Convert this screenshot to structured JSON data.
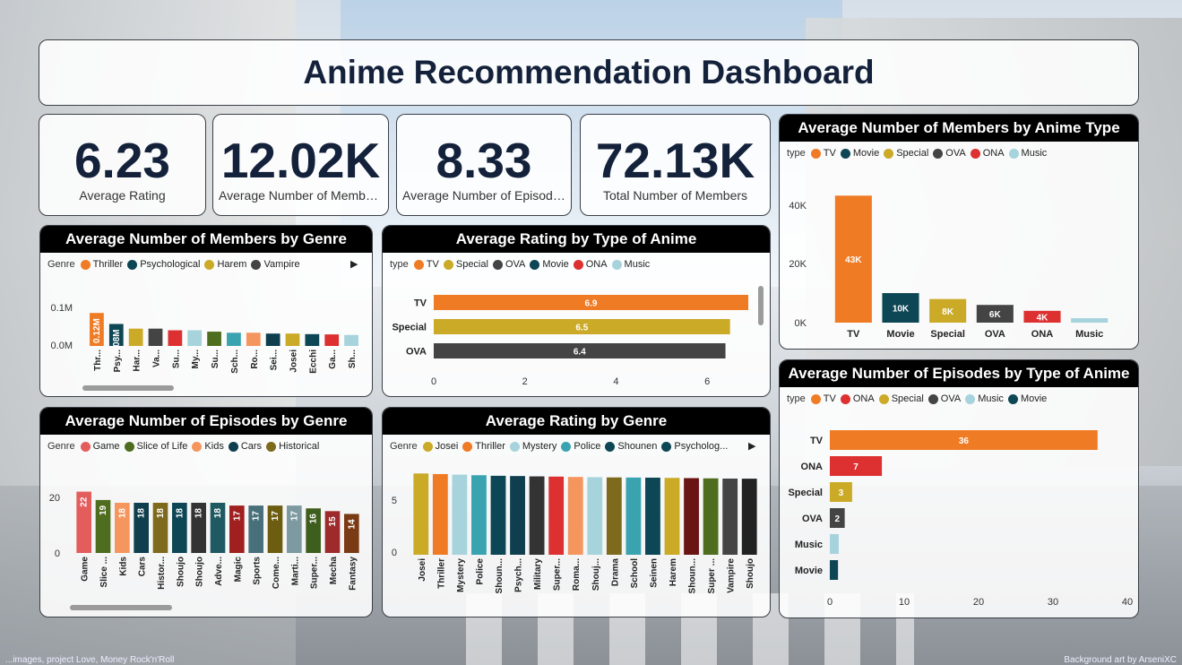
{
  "colors": {
    "TV": "#f07b25",
    "Movie": "#0d4654",
    "Special": "#cbaa27",
    "OVA": "#444444",
    "ONA": "#dd3030",
    "Music": "#a6d3dc"
  },
  "header": {
    "title": "Anime Recommendation Dashboard"
  },
  "kpis": [
    {
      "value": "6.23",
      "label": "Average Rating"
    },
    {
      "value": "12.02K",
      "label": "Average Number of Members"
    },
    {
      "value": "8.33",
      "label": "Average Number of Episodes"
    },
    {
      "value": "72.13K",
      "label": "Total Number of Members"
    }
  ],
  "chart_data": [
    {
      "id": "members_by_genre",
      "type": "bar",
      "title": "Average Number of Members by Genre",
      "legend_title": "Genre",
      "legend": [
        {
          "name": "Thriller",
          "color": "#f07b25"
        },
        {
          "name": "Psychological",
          "color": "#0d4654"
        },
        {
          "name": "Harem",
          "color": "#cbaa27"
        },
        {
          "name": "Vampire",
          "color": "#444444"
        }
      ],
      "yticks": [
        "0.1M",
        "0.0M"
      ],
      "ylim": [
        0,
        0.15
      ],
      "categories": [
        "Thr...",
        "Psy...",
        "Har...",
        "Va...",
        "Su...",
        "My...",
        "Su...",
        "Sch...",
        "Ro...",
        "Sei...",
        "Josei",
        "Ecchi",
        "Ga...",
        "Sh..."
      ],
      "values": [
        0.12,
        0.08,
        0.063,
        0.063,
        0.057,
        0.057,
        0.052,
        0.048,
        0.048,
        0.045,
        0.045,
        0.043,
        0.042,
        0.04
      ],
      "labels": [
        "0.12M",
        "0.08M",
        "",
        "",
        "",
        "",
        "",
        "",
        "",
        "",
        "",
        "",
        "",
        ""
      ],
      "bar_colors": [
        "#f07b25",
        "#0d4654",
        "#cbaa27",
        "#444444",
        "#dd3030",
        "#a6d3dc",
        "#4f6d1f",
        "#3aa3b0",
        "#f4965d",
        "#0f3e4e",
        "#cbaa27",
        "#0d4654",
        "#dd3030",
        "#a6d3dc"
      ]
    },
    {
      "id": "rating_by_type",
      "type": "bar",
      "orientation": "horizontal",
      "title": "Average Rating by Type of Anime",
      "legend_title": "type",
      "legend": [
        {
          "name": "TV",
          "color": "#f07b25"
        },
        {
          "name": "Special",
          "color": "#cbaa27"
        },
        {
          "name": "OVA",
          "color": "#444444"
        },
        {
          "name": "Movie",
          "color": "#0d4654"
        },
        {
          "name": "ONA",
          "color": "#dd3030"
        },
        {
          "name": "Music",
          "color": "#a6d3dc"
        }
      ],
      "categories": [
        "TV",
        "Special",
        "OVA"
      ],
      "values": [
        6.9,
        6.5,
        6.4
      ],
      "labels": [
        "6.9",
        "6.5",
        "6.4"
      ],
      "bar_colors": [
        "#f07b25",
        "#cbaa27",
        "#444444"
      ],
      "xticks": [
        "0",
        "2",
        "4",
        "6"
      ],
      "xlim": [
        0,
        6.9
      ]
    },
    {
      "id": "members_by_type",
      "type": "bar",
      "title": "Average Number of Members by Anime Type",
      "legend_title": "type",
      "legend": [
        {
          "name": "TV",
          "color": "#f07b25"
        },
        {
          "name": "Movie",
          "color": "#0d4654"
        },
        {
          "name": "Special",
          "color": "#cbaa27"
        },
        {
          "name": "OVA",
          "color": "#444444"
        },
        {
          "name": "ONA",
          "color": "#dd3030"
        },
        {
          "name": "Music",
          "color": "#a6d3dc"
        }
      ],
      "yticks": [
        "40K",
        "20K",
        "0K"
      ],
      "ylim": [
        0,
        40000
      ],
      "categories": [
        "TV",
        "Movie",
        "Special",
        "OVA",
        "ONA",
        "Music"
      ],
      "values": [
        43000,
        10000,
        8000,
        6000,
        4000,
        1500
      ],
      "labels": [
        "43K",
        "10K",
        "8K",
        "6K",
        "4K",
        ""
      ],
      "bar_colors": [
        "#f07b25",
        "#0d4654",
        "#cbaa27",
        "#444444",
        "#dd3030",
        "#a6d3dc"
      ]
    },
    {
      "id": "episodes_by_genre",
      "type": "bar",
      "title": "Average Number of Episodes by Genre",
      "legend_title": "Genre",
      "legend": [
        {
          "name": "Game",
          "color": "#e35d5d"
        },
        {
          "name": "Slice of Life",
          "color": "#4f6d1f"
        },
        {
          "name": "Kids",
          "color": "#f4965d"
        },
        {
          "name": "Cars",
          "color": "#0f3e4e"
        },
        {
          "name": "Historical",
          "color": "#7d6a1c"
        }
      ],
      "yticks": [
        "20",
        "0"
      ],
      "ylim": [
        0,
        20
      ],
      "categories": [
        "Game",
        "Slice ...",
        "Kids",
        "Cars",
        "Histor...",
        "Shoujo",
        "Shoujo",
        "Adve...",
        "Magic",
        "Sports",
        "Come...",
        "Marti...",
        "Super...",
        "Mecha",
        "Fantasy"
      ],
      "values": [
        22,
        19,
        18,
        18,
        18,
        18,
        18,
        18,
        17,
        17,
        17,
        17,
        16,
        15,
        14
      ],
      "labels": [
        "22",
        "19",
        "18",
        "18",
        "18",
        "18",
        "18",
        "18",
        "17",
        "17",
        "17",
        "17",
        "16",
        "15",
        "14"
      ],
      "bar_colors": [
        "#e35d5d",
        "#4f6d1f",
        "#f4965d",
        "#0f3e4e",
        "#7d6a1c",
        "#0d4654",
        "#333333",
        "#1f5a63",
        "#a01f1f",
        "#48707a",
        "#6c5d10",
        "#7c9aa0",
        "#3e5e1d",
        "#9e2b2b",
        "#7a3b14"
      ]
    },
    {
      "id": "rating_by_genre",
      "type": "bar",
      "title": "Average Rating by Genre",
      "legend_title": "Genre",
      "legend": [
        {
          "name": "Josei",
          "color": "#cbaa27"
        },
        {
          "name": "Thriller",
          "color": "#f07b25"
        },
        {
          "name": "Mystery",
          "color": "#a6d3dc"
        },
        {
          "name": "Police",
          "color": "#3aa3b0"
        },
        {
          "name": "Shounen",
          "color": "#0d4654"
        },
        {
          "name": "Psycholog...",
          "color": "#0d4654"
        }
      ],
      "yticks": [
        "5",
        "0"
      ],
      "ylim": [
        0,
        5
      ],
      "categories": [
        "Josei",
        "Thriller",
        "Mystery",
        "Police",
        "Shoun...",
        "Psych...",
        "Military",
        "Super...",
        "Roma...",
        "Shouj...",
        "Drama",
        "School",
        "Seinen",
        "Harem",
        "Shoun...",
        "Super ...",
        "Vampire",
        "Shoujo"
      ],
      "values": [
        7.0,
        6.95,
        6.9,
        6.85,
        6.8,
        6.78,
        6.75,
        6.73,
        6.7,
        6.68,
        6.66,
        6.65,
        6.64,
        6.62,
        6.6,
        6.58,
        6.56,
        6.55
      ],
      "bar_colors": [
        "#cbaa27",
        "#f07b25",
        "#a6d3dc",
        "#3aa3b0",
        "#0d4654",
        "#0f3e4e",
        "#333333",
        "#dd3030",
        "#f4965d",
        "#a6d3dc",
        "#7d6a1c",
        "#3aa3b0",
        "#0d4654",
        "#cbaa27",
        "#6b1414",
        "#4f6d1f",
        "#444444",
        "#222222"
      ]
    },
    {
      "id": "episodes_by_type",
      "type": "bar",
      "orientation": "horizontal",
      "title": "Average Number of Episodes by Type of Anime",
      "legend_title": "type",
      "legend": [
        {
          "name": "TV",
          "color": "#f07b25"
        },
        {
          "name": "ONA",
          "color": "#dd3030"
        },
        {
          "name": "Special",
          "color": "#cbaa27"
        },
        {
          "name": "OVA",
          "color": "#444444"
        },
        {
          "name": "Music",
          "color": "#a6d3dc"
        },
        {
          "name": "Movie",
          "color": "#0d4654"
        }
      ],
      "categories": [
        "TV",
        "ONA",
        "Special",
        "OVA",
        "Music",
        "Movie"
      ],
      "values": [
        36,
        7,
        3,
        2,
        1.2,
        1.1
      ],
      "labels": [
        "36",
        "7",
        "3",
        "2",
        "",
        ""
      ],
      "bar_colors": [
        "#f07b25",
        "#dd3030",
        "#cbaa27",
        "#444444",
        "#a6d3dc",
        "#0d4654"
      ],
      "xticks": [
        "0",
        "10",
        "20",
        "30",
        "40"
      ],
      "xlim": [
        0,
        40
      ]
    }
  ],
  "footer": {
    "left": "...images, project Love, Money Rock'n'Roll",
    "right": "Background art by ArseniXC"
  }
}
